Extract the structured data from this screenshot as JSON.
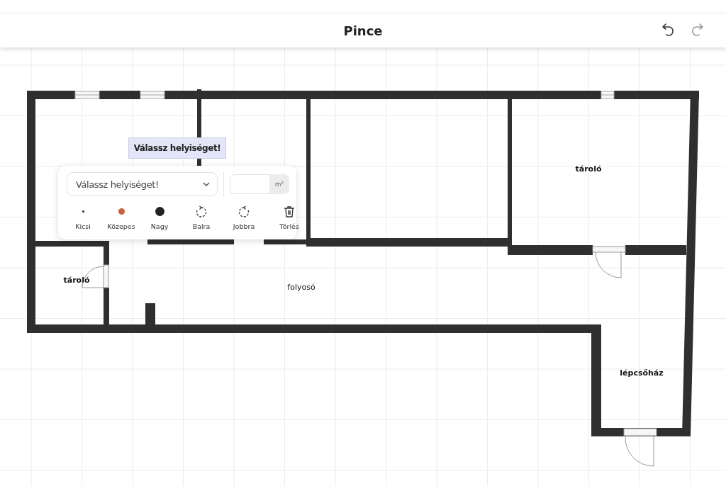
{
  "header": {
    "title": "Pince",
    "undo": {
      "disabled": false
    },
    "redo": {
      "disabled": true
    }
  },
  "rooms": [
    {
      "label": "tároló"
    },
    {
      "label": "tároló"
    },
    {
      "label": "folyosó"
    },
    {
      "label": "lépcsőház"
    }
  ],
  "tooltip": {
    "text": "Válassz helyiséget!"
  },
  "room_popup": {
    "room_select": {
      "placeholder": "Válassz helyiséget!"
    },
    "area": {
      "unit": "m²"
    },
    "sizes": [
      {
        "kind": "small",
        "label": "Kicsi",
        "selected": false
      },
      {
        "kind": "medium",
        "label": "Közepes",
        "selected": true
      },
      {
        "kind": "large",
        "label": "Nagy",
        "selected": false
      }
    ],
    "actions": [
      {
        "kind": "rotate-left",
        "label": "Balra"
      },
      {
        "kind": "rotate-right",
        "label": "Jobbra"
      },
      {
        "kind": "delete",
        "label": "Törlés"
      }
    ]
  }
}
